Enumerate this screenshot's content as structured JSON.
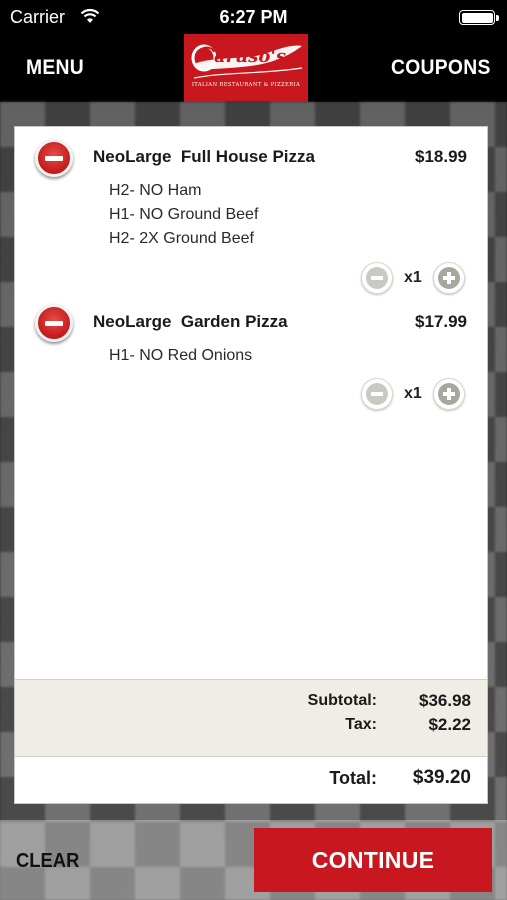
{
  "status_bar": {
    "carrier": "Carrier",
    "time": "6:27 PM"
  },
  "nav": {
    "menu_label": "MENU",
    "coupons_label": "COUPONS",
    "logo_text": "Caruso's",
    "logo_subtext": "ITALIAN RESTAURANT & PIZZERIA"
  },
  "cart": {
    "items": [
      {
        "name": "NeoLarge  Full House Pizza",
        "price": "$18.99",
        "modifiers": [
          "H2- NO Ham",
          "H1- NO Ground Beef",
          "H2- 2X Ground Beef"
        ],
        "quantity": "x1"
      },
      {
        "name": "NeoLarge  Garden Pizza",
        "price": "$17.99",
        "modifiers": [
          "H1- NO Red Onions"
        ],
        "quantity": "x1"
      }
    ],
    "subtotal_label": "Subtotal:",
    "subtotal_value": "$36.98",
    "tax_label": "Tax:",
    "tax_value": "$2.22",
    "total_label": "Total:",
    "total_value": "$39.20"
  },
  "actions": {
    "clear_label": "CLEAR",
    "continue_label": "CONTINUE"
  },
  "colors": {
    "brand_red": "#c8171e",
    "summary_bg": "#efede6"
  }
}
